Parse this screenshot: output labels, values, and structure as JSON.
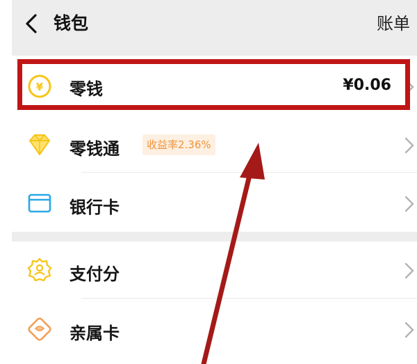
{
  "header": {
    "title": "钱包",
    "action": "账单"
  },
  "rows": [
    {
      "label": "零钱",
      "value": "¥0.06"
    },
    {
      "label": "零钱通",
      "badge": "收益率2.36%"
    },
    {
      "label": "银行卡"
    },
    {
      "label": "支付分"
    },
    {
      "label": "亲属卡"
    }
  ],
  "colors": {
    "header_bg": "#ededed",
    "accent_yellow": "#f5c518",
    "card_blue": "#2aa7e6",
    "annotation_red": "#c01515"
  },
  "icons": [
    "chevron-left-icon",
    "yuan-coin-icon",
    "diamond-icon",
    "bank-card-icon",
    "badge-icon",
    "heart-card-icon",
    "chevron-right-icon"
  ]
}
